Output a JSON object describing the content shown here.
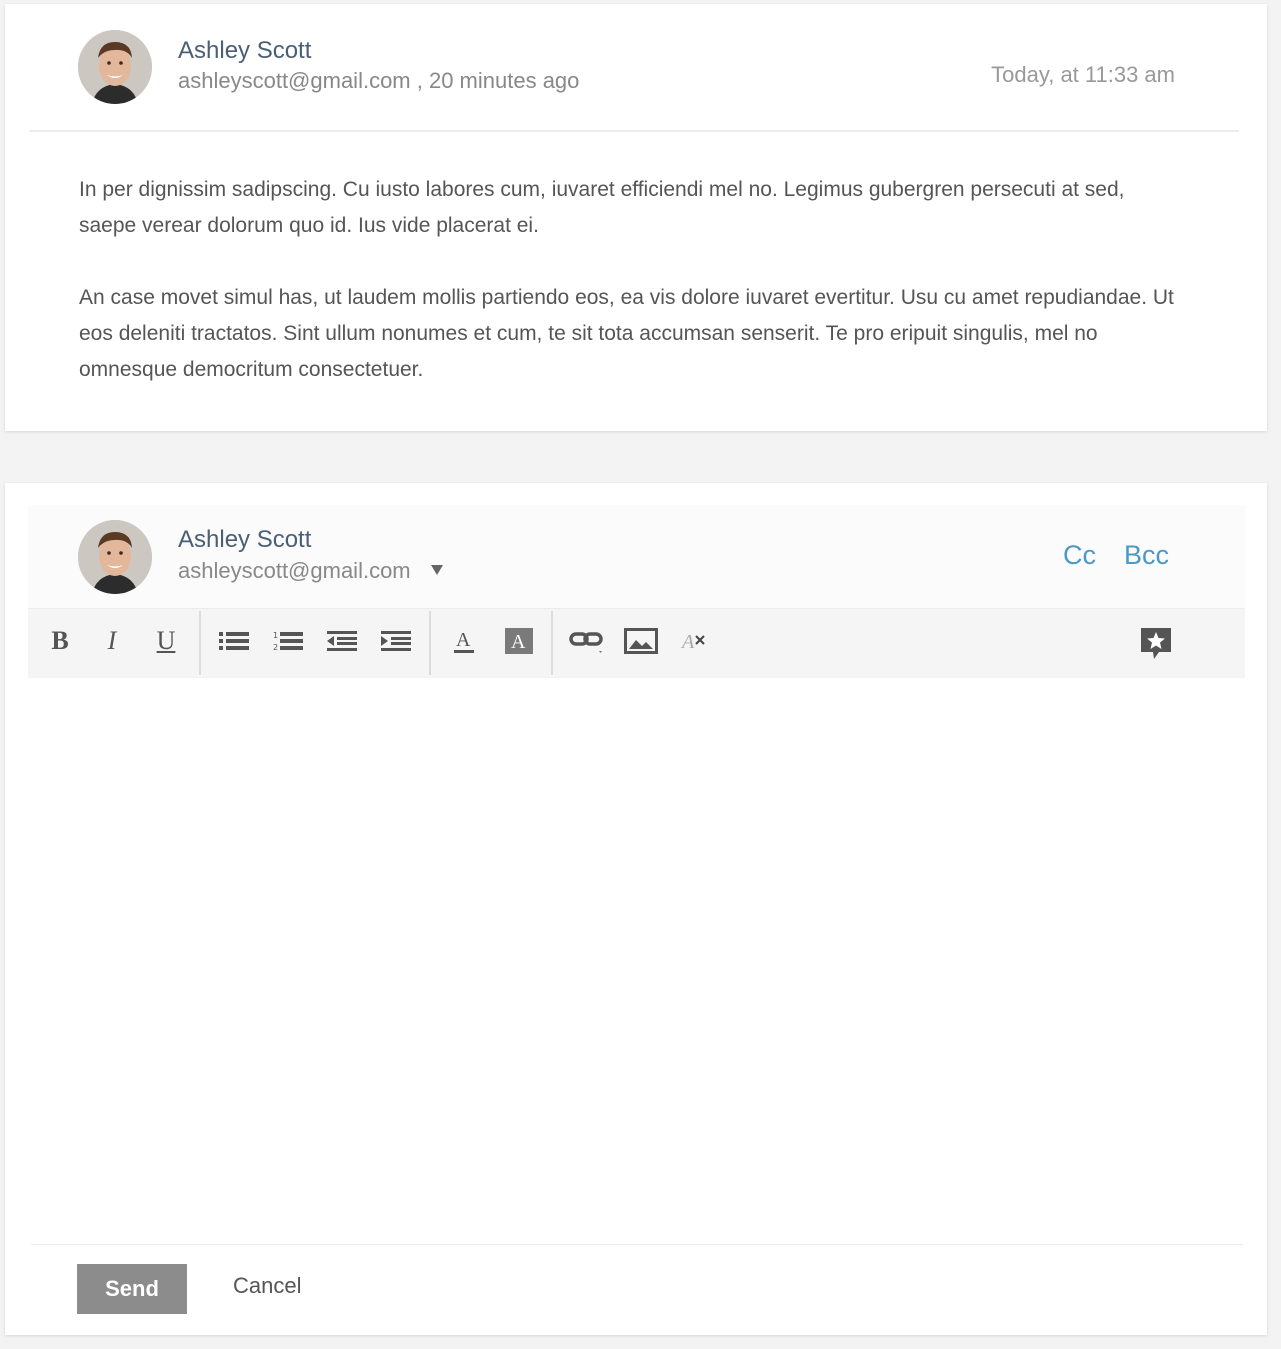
{
  "message": {
    "sender_name": "Ashley Scott",
    "sender_meta": "ashleyscott@gmail.com , 20 minutes ago",
    "date": "Today, at 11:33 am",
    "paragraphs": [
      "In per dignissim sadipscing. Cu iusto labores cum, iuvaret efficiendi mel no. Legimus gubergren persecuti at sed, saepe verear dolorum quo id. Ius vide placerat ei.",
      "An case movet simul has, ut laudem mollis partiendo eos, ea vis dolore iuvaret evertitur. Usu cu amet repudiandae. Ut eos deleniti tractatos. Sint ullum nonumes et cum, te sit tota accumsan senserit. Te pro eripuit singulis, mel no omnesque democritum consectetuer."
    ]
  },
  "compose": {
    "from_name": "Ashley Scott",
    "from_email": "ashleyscott@gmail.com",
    "cc_label": "Cc",
    "bcc_label": "Bcc",
    "toolbar": [
      "bold-icon",
      "italic-icon",
      "underline-icon",
      "bullet-list-icon",
      "numbered-list-icon",
      "outdent-icon",
      "indent-icon",
      "text-color-icon",
      "background-color-icon",
      "link-icon",
      "image-icon",
      "clear-format-icon",
      "comment-star-icon"
    ],
    "send_label": "Send",
    "cancel_label": "Cancel"
  }
}
